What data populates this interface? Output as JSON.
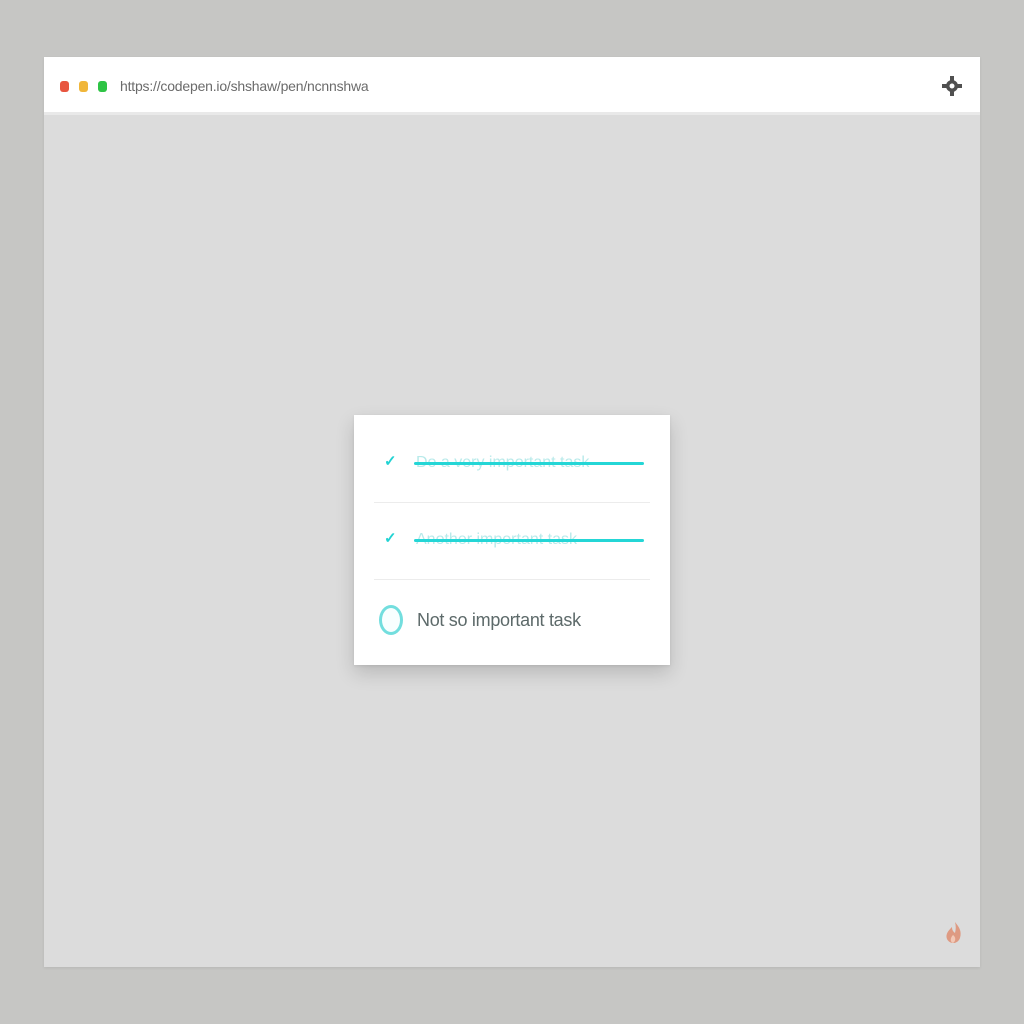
{
  "browser": {
    "url": "https://codepen.io/shshaw/pen/ncnnshwa",
    "window_controls": [
      "close",
      "minimize",
      "zoom"
    ],
    "settings_icon": "gear-icon"
  },
  "todo": {
    "tasks": [
      {
        "label": "Do a very important task",
        "done": true
      },
      {
        "label": "Another important task",
        "done": true
      },
      {
        "label": "Not so important task",
        "done": false
      }
    ]
  },
  "colors": {
    "accent": "#24d6d6",
    "page_background": "#dcdcdc",
    "card_background": "#ffffff"
  },
  "corner_icon": "flame-icon"
}
